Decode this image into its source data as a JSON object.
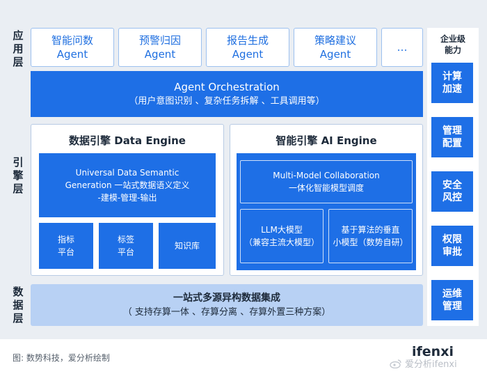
{
  "layers": {
    "app": "应用层",
    "engine": "引擎层",
    "data": "数据层"
  },
  "agents": [
    {
      "line1": "智能问数",
      "line2": "Agent"
    },
    {
      "line1": "预警归因",
      "line2": "Agent"
    },
    {
      "line1": "报告生成",
      "line2": "Agent"
    },
    {
      "line1": "策略建议",
      "line2": "Agent"
    },
    {
      "line1": "…",
      "line2": ""
    }
  ],
  "orchestration": {
    "title": "Agent Orchestration",
    "subtitle": "（用户意图识别 、复杂任务拆解 、工具调用等）"
  },
  "data_engine": {
    "title": "数据引擎 Data Engine",
    "main_line1": "Universal Data Semantic",
    "main_line2": "Generation 一站式数据语义定义",
    "main_line3": "-建模-管理-输出",
    "sub1_line1": "指标",
    "sub1_line2": "平台",
    "sub2_line1": "标签",
    "sub2_line2": "平台",
    "sub3": "知识库"
  },
  "ai_engine": {
    "title": "智能引擎 AI Engine",
    "top_line1": "Multi-Model Collaboration",
    "top_line2": "一体化智能模型调度",
    "left_line1": "LLM大模型",
    "left_line2": "（兼容主流大模型）",
    "right_line1": "基于算法的垂直",
    "right_line2": "小模型（数势自研）"
  },
  "data_integration": {
    "title": "一站式多源异构数据集成",
    "subtitle": "（ 支持存算一体 、存算分离 、存算外置三种方案）"
  },
  "enterprise": {
    "title_line1": "企业级",
    "title_line2": "能力",
    "items": [
      {
        "line1": "计算",
        "line2": "加速"
      },
      {
        "line1": "管理",
        "line2": "配置"
      },
      {
        "line1": "安全",
        "line2": "风控"
      },
      {
        "line1": "权限",
        "line2": "审批"
      },
      {
        "line1": "运维",
        "line2": "管理"
      }
    ]
  },
  "footer": {
    "caption": "图: 数势科技，爱分析绘制",
    "logo_main": "ifenxi",
    "watermark": "爱分析ifenxi"
  },
  "colors": {
    "primary": "#1e6fe6",
    "panel": "#eaeef3",
    "data_bar": "#b8d1f4"
  }
}
